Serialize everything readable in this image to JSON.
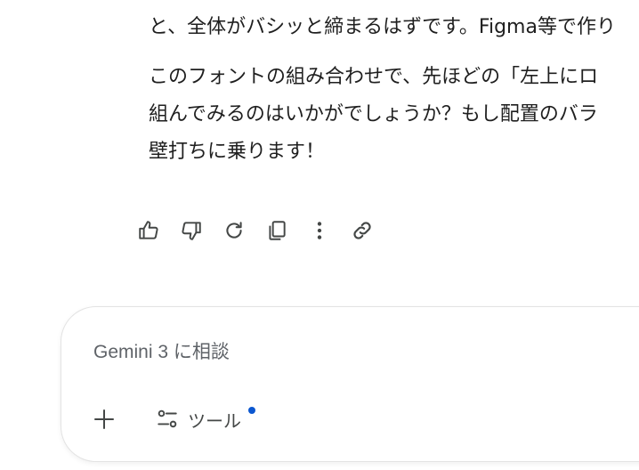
{
  "response": {
    "paragraphs": [
      {
        "lines": [
          "と、全体がバシッと締まるはずです。Figma等で作り"
        ]
      },
      {
        "lines": [
          "このフォントの組み合わせで、先ほどの「左上にロ",
          "組んでみるのはいかがでしょうか？もし配置のバラ",
          "壁打ちに乗ります！"
        ]
      }
    ]
  },
  "actions": {
    "icons": [
      "thumbs-up-icon",
      "thumbs-down-icon",
      "redo-icon",
      "copy-icon",
      "more-vert-icon",
      "link-icon"
    ]
  },
  "composer": {
    "placeholder": "Gemini 3 に相談",
    "tools_label": "ツール",
    "add_icon": "plus-icon",
    "tools_icon": "tune-icon",
    "indicator_color": "#0b57d0"
  },
  "colors": {
    "text": "#1f1f1f",
    "icon": "#444746",
    "placeholder": "#5f6368",
    "border": "#e3e3e3"
  }
}
